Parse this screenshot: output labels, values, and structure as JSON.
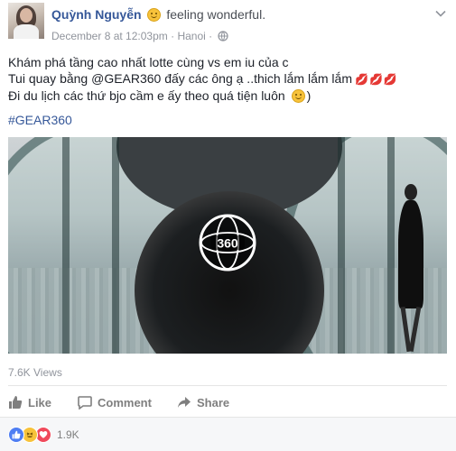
{
  "post": {
    "author": "Quỳnh Nguyễn",
    "feeling_text": "feeling wonderful.",
    "feeling_icon": "smile-emoji-icon",
    "date": "December 8 at 12:03pm",
    "separator": "·",
    "location": "Hanoi",
    "privacy_separator": "·",
    "privacy_icon": "globe-icon",
    "text_lines": [
      "Khám phá tầng cao nhất lotte cùng vs em iu của c",
      "Tui quay bằng @GEAR360 đấy các ông ạ ..thich lắm lắm lắm",
      "Đi du lịch các thứ bjo cầm e ấy theo quá tiện luôn"
    ],
    "kiss_emojis": "💋💋💋",
    "closing_paren": ")",
    "hashtag": "#GEAR360",
    "video_badge": "360",
    "views": "7.6K Views"
  },
  "actions": {
    "like_label": "Like",
    "comment_label": "Comment",
    "share_label": "Share"
  },
  "reactions": {
    "icons": [
      "like-reaction-icon",
      "haha-reaction-icon",
      "love-reaction-icon"
    ],
    "count": "1.9K"
  },
  "colors": {
    "link_blue": "#365899",
    "meta_gray": "#90949c",
    "action_gray": "#7f7f7f"
  }
}
